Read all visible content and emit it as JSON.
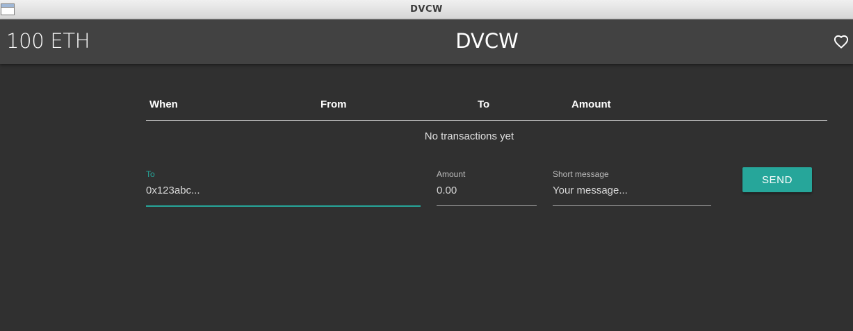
{
  "window": {
    "title": "DVCW",
    "icon": "window-icon"
  },
  "appbar": {
    "balance": "100 ETH",
    "title": "DVCW",
    "favorite_icon": "heart-outline-icon"
  },
  "transactions": {
    "columns": [
      "When",
      "From",
      "To",
      "Amount"
    ],
    "rows": [],
    "empty_message": "No transactions yet"
  },
  "send_form": {
    "to": {
      "label": "To",
      "placeholder": "0x123abc...",
      "value": ""
    },
    "amount": {
      "label": "Amount",
      "placeholder": "0.00",
      "value": ""
    },
    "message": {
      "label": "Short message",
      "placeholder": "Your message...",
      "value": ""
    },
    "send_label": "SEND"
  },
  "colors": {
    "accent": "#26a69a",
    "appbar": "#424242",
    "background": "#303030"
  }
}
